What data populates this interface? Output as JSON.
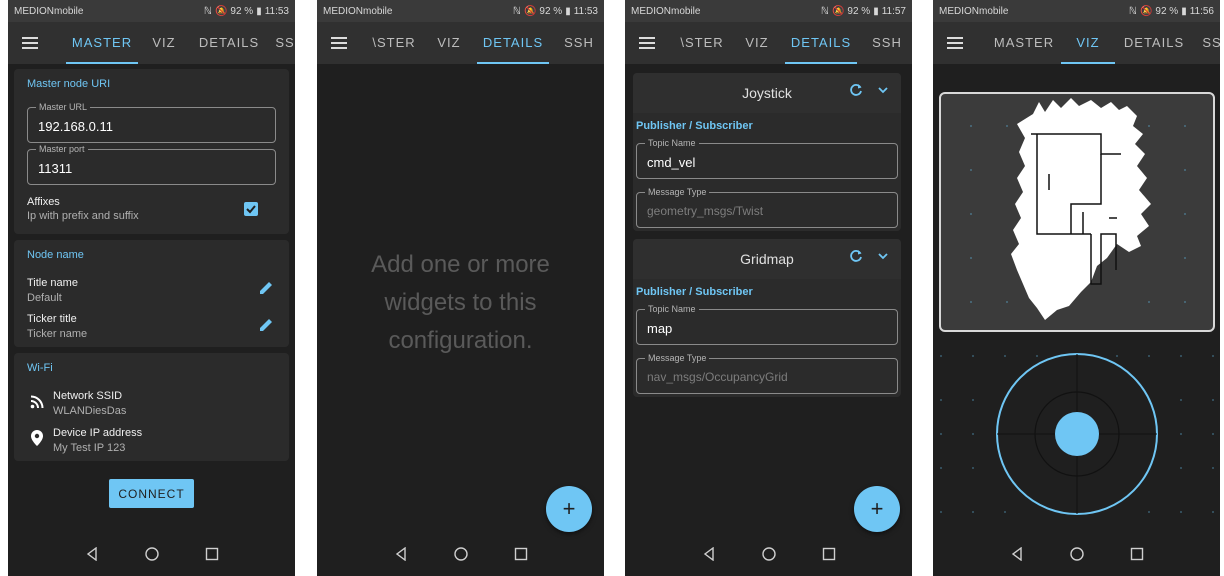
{
  "status_bars": [
    {
      "carrier": "MEDIONmobile",
      "battery": "92 %",
      "time": "11:53"
    },
    {
      "carrier": "MEDIONmobile",
      "battery": "92 %",
      "time": "11:53"
    },
    {
      "carrier": "MEDIONmobile",
      "battery": "92 %",
      "time": "11:57"
    },
    {
      "carrier": "MEDIONmobile",
      "battery": "92 %",
      "time": "11:56"
    }
  ],
  "screen1": {
    "tabs": [
      "MASTER",
      "VIZ",
      "DETAILS",
      "SS"
    ],
    "master_card": {
      "title": "Master node URI",
      "url_label": "Master URL",
      "url_value": "192.168.0.11",
      "port_label": "Master port",
      "port_value": "11311",
      "affixes_title": "Affixes",
      "affixes_sub": "Ip with prefix and suffix"
    },
    "node_card": {
      "title": "Node name",
      "title_name_label": "Title name",
      "title_name_value": "Default",
      "ticker_label": "Ticker title",
      "ticker_value": "Ticker name"
    },
    "wifi_card": {
      "title": "Wi-Fi",
      "ssid_label": "Network SSID",
      "ssid_value": "WLANDiesDas",
      "ip_label": "Device IP address",
      "ip_value": "My Test IP 123"
    },
    "connect_label": "CONNECT"
  },
  "screen2": {
    "tabs": [
      "\\STER",
      "VIZ",
      "DETAILS",
      "SSH"
    ],
    "empty_line1": "Add one or more",
    "empty_line2": "widgets to this",
    "empty_line3": "configuration.",
    "fab_label": "+"
  },
  "screen3": {
    "tabs": [
      "\\STER",
      "VIZ",
      "DETAILS",
      "SSH"
    ],
    "widgets": [
      {
        "name": "Joystick",
        "section": "Publisher / Subscriber",
        "topic_label": "Topic Name",
        "topic_value": "cmd_vel",
        "type_label": "Message Type",
        "type_value": "geometry_msgs/Twist"
      },
      {
        "name": "Gridmap",
        "section": "Publisher / Subscriber",
        "topic_label": "Topic Name",
        "topic_value": "map",
        "type_label": "Message Type",
        "type_value": "nav_msgs/OccupancyGrid"
      }
    ],
    "fab_label": "+"
  },
  "screen4": {
    "tabs": [
      "MASTER",
      "VIZ",
      "DETAILS",
      "SS"
    ]
  },
  "colors": {
    "accent": "#6fc6f4",
    "background": "#1f1f1f",
    "card": "#2b2b2b",
    "appbar": "#303030"
  }
}
